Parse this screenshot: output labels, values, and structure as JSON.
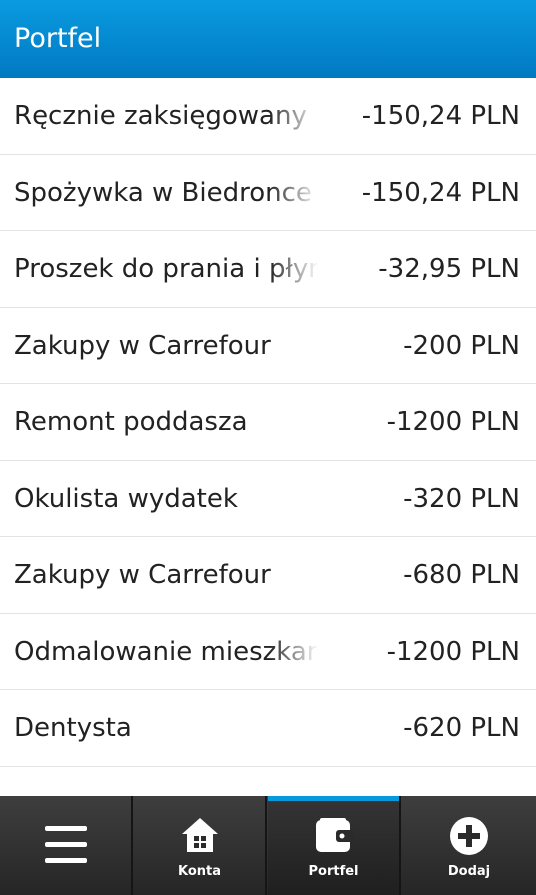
{
  "header": {
    "title": "Portfel"
  },
  "transactions": [
    {
      "name": "Ręcznie zaksięgowany wydatek",
      "amount": "-150,24 PLN"
    },
    {
      "name": "Spożywka w Biedronce",
      "amount": "-150,24 PLN"
    },
    {
      "name": "Proszek do prania i płyn",
      "amount": "-32,95 PLN"
    },
    {
      "name": "Zakupy w Carrefour",
      "amount": "-200 PLN"
    },
    {
      "name": "Remont poddasza",
      "amount": "-1200 PLN"
    },
    {
      "name": "Okulista wydatek",
      "amount": "-320 PLN"
    },
    {
      "name": "Zakupy w Carrefour",
      "amount": "-680 PLN"
    },
    {
      "name": "Odmalowanie mieszkania",
      "amount": "-1200 PLN"
    },
    {
      "name": "Dentysta",
      "amount": "-620 PLN"
    }
  ],
  "tabbar": {
    "menu": {
      "icon": "menu-icon"
    },
    "konta": {
      "label": "Konta",
      "icon": "home-icon"
    },
    "portfel": {
      "label": "Portfel",
      "icon": "wallet-icon",
      "active": true
    },
    "dodaj": {
      "label": "Dodaj",
      "icon": "add-circle-icon"
    }
  },
  "colors": {
    "accent": "#0a98dd",
    "header": "#0079c2"
  }
}
